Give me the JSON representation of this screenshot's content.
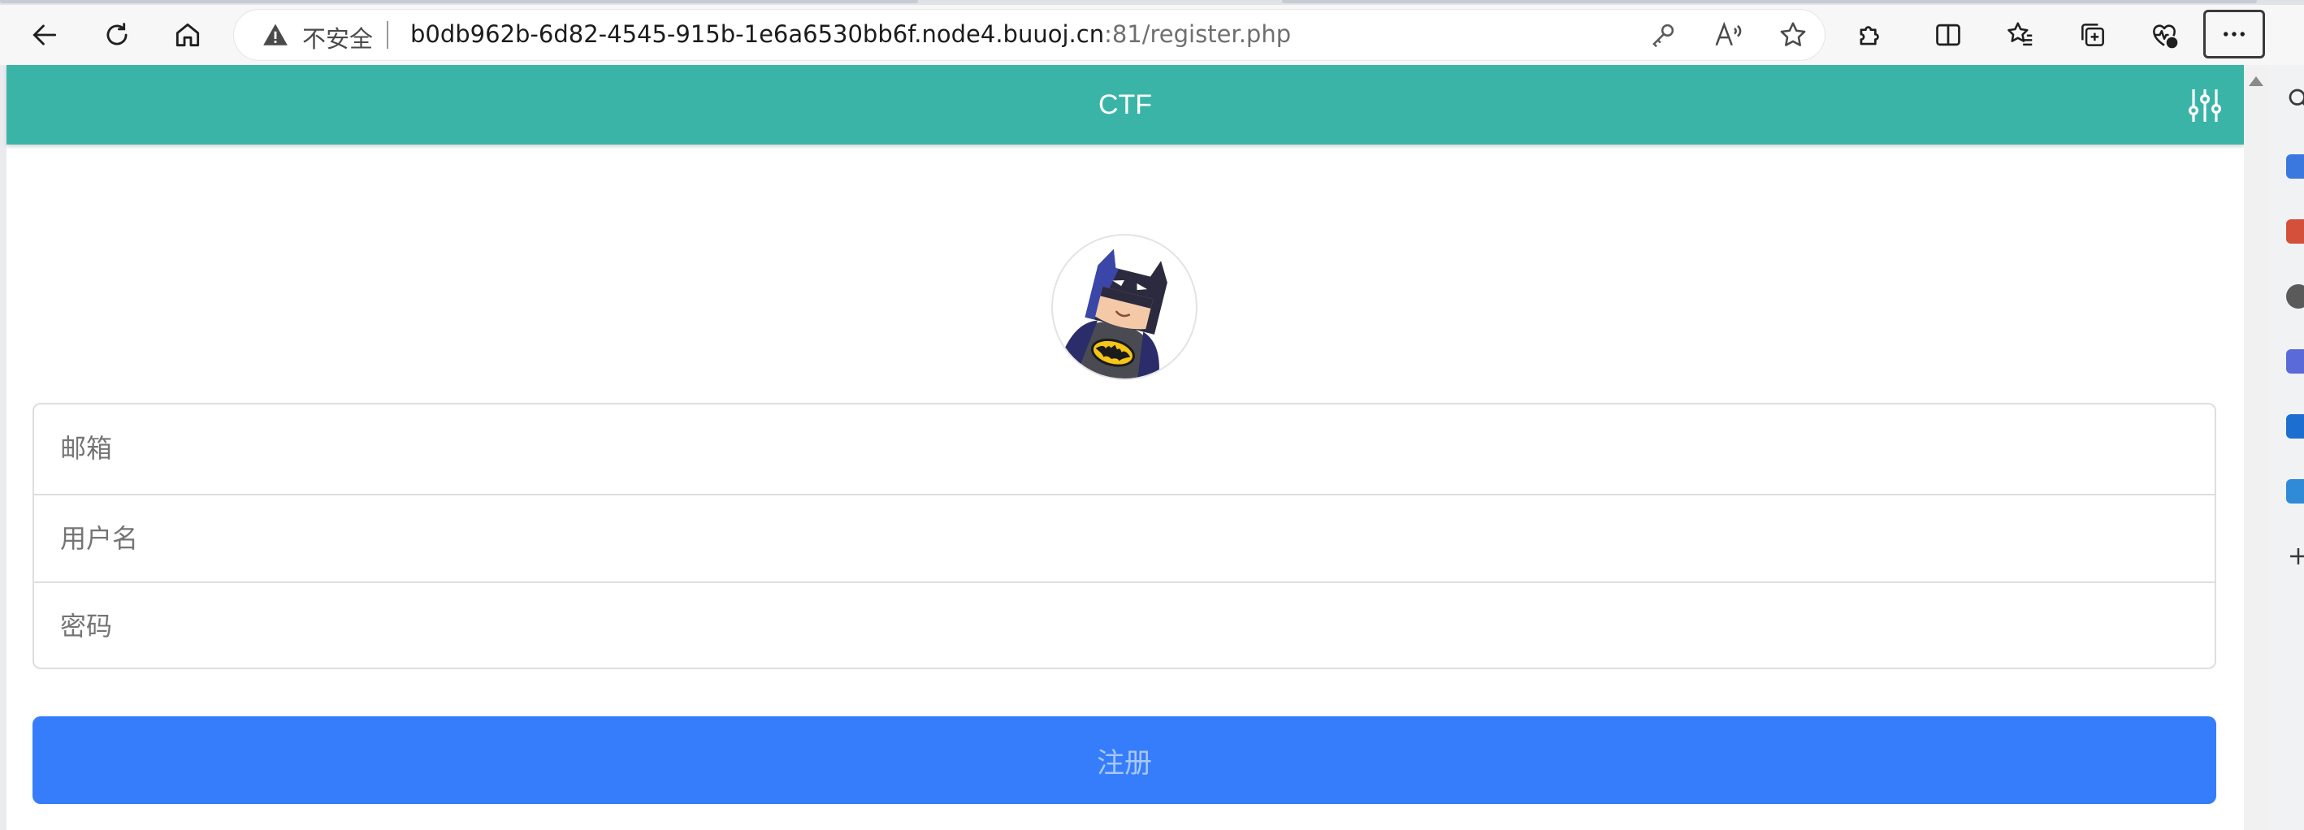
{
  "browser": {
    "security_label": "不安全",
    "url_main": "b0db962b-6d82-4545-915b-1e6a6530bb6f.node4.buuoj.cn",
    "url_rest": ":81/register.php",
    "icons": {
      "back": "arrow-left-icon",
      "refresh": "refresh-icon",
      "home": "home-icon",
      "warning": "warning-icon",
      "password": "key-icon",
      "read_aloud": "read-aloud-icon",
      "favorite": "star-icon",
      "extensions": "puzzle-icon",
      "split_screen": "split-screen-icon",
      "favorites": "favorites-icon",
      "collections": "collections-icon",
      "performance": "heartbeat-icon",
      "menu": "more-icon"
    }
  },
  "site": {
    "header_title": "CTF",
    "header_color": "#3bb4a8",
    "avatar": "batman-avatar"
  },
  "form": {
    "email_placeholder": "邮箱",
    "username_placeholder": "用户名",
    "password_placeholder": "密码",
    "submit_label": "注册",
    "submit_color": "#367dfb"
  },
  "sidebar": {
    "items": [
      "search-icon",
      "copilot-icon",
      "shopping-icon",
      "people-icon",
      "games-icon",
      "outlook-icon",
      "drop-icon",
      "add-icon"
    ]
  }
}
